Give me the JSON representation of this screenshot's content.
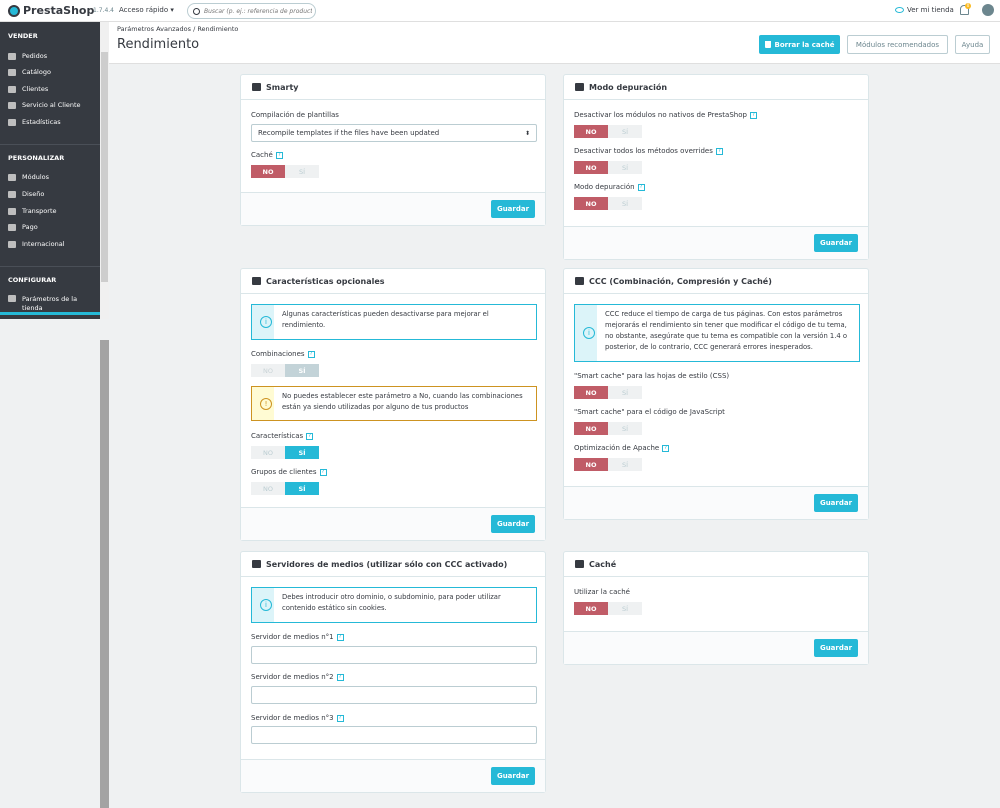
{
  "header": {
    "logo": "PrestaShop",
    "version": "1.7.4.4",
    "quick_access": "Acceso rápido ▾",
    "search_placeholder": "Buscar (p. ej.: referencia de producto, n",
    "view_store": "Ver mi tienda",
    "notification_count": "0"
  },
  "sidebar": {
    "sections": [
      {
        "title": "VENDER",
        "items": [
          "Pedidos",
          "Catálogo",
          "Clientes",
          "Servicio al Cliente",
          "Estadísticas"
        ]
      },
      {
        "title": "PERSONALIZAR",
        "items": [
          "Módulos",
          "Diseño",
          "Transporte",
          "Pago",
          "Internacional"
        ]
      },
      {
        "title": "CONFIGURAR",
        "items": [
          "Parámetros de la",
          "tienda"
        ]
      }
    ]
  },
  "page": {
    "breadcrumb": "Parámetros Avanzados  /  Rendimiento",
    "title": "Rendimiento",
    "clear_cache": "Borrar la caché",
    "recommended_modules": "Módulos recomendados",
    "help": "Ayuda"
  },
  "smarty": {
    "title": "Smarty",
    "compile_label": "Compilación de plantillas",
    "compile_value": "Recompile templates if the files have been updated",
    "cache_label": "Caché",
    "save": "Guardar"
  },
  "debug": {
    "title": "Modo depuración",
    "disable_modules_label": "Desactivar los módulos no nativos de PrestaShop",
    "disable_overrides_label": "Desactivar todos los métodos overrides",
    "debug_mode_label": "Modo depuración",
    "save": "Guardar"
  },
  "optional": {
    "title": "Características opcionales",
    "info": "Algunas características pueden desactivarse para mejorar el rendimiento.",
    "combinations_label": "Combinaciones",
    "warning": "No puedes establecer este parámetro a No, cuando las combinaciones están ya siendo utilizadas por alguno de tus productos",
    "features_label": "Características",
    "groups_label": "Grupos de clientes",
    "save": "Guardar"
  },
  "ccc": {
    "title": "CCC (Combinación, Compresión y Caché)",
    "info": "CCC reduce el tiempo de carga de tus páginas. Con estos parámetros mejorarás el rendimiento sin tener que modificar el código de tu tema, no obstante, asegúrate que tu tema es compatible con la versión 1.4 o posterior, de lo contrario, CCC generará errores inesperados.",
    "css_label": "\"Smart cache\" para las hojas de estilo (CSS)",
    "js_label": "\"Smart cache\" para el código de JavaScript",
    "apache_label": "Optimización de Apache",
    "save": "Guardar"
  },
  "media": {
    "title": "Servidores de medios (utilizar sólo con CCC activado)",
    "info": "Debes introducir otro dominio, o subdominio, para poder utilizar contenido estático sin cookies.",
    "server1_label": "Servidor de medios n°1",
    "server2_label": "Servidor de medios n°2",
    "server3_label": "Servidor de medios n°3",
    "server1_value": "",
    "server2_value": "",
    "server3_value": "",
    "save": "Guardar"
  },
  "cache": {
    "title": "Caché",
    "use_cache_label": "Utilizar la caché",
    "save": "Guardar"
  },
  "switch": {
    "no": "NO",
    "yes": "SÍ"
  },
  "help_mark": "?",
  "colors": {
    "accent": "#25b9d7",
    "danger": "#c05c67",
    "sidebar": "#363a41",
    "warning": "#cd9321"
  },
  "icons": [
    "search-icon",
    "eye-icon",
    "bell-icon",
    "user-icon",
    "trash-icon",
    "briefcase-icon",
    "bug-icon",
    "puzzle-icon",
    "expand-icon",
    "link-icon",
    "info-icon",
    "warning-icon"
  ]
}
